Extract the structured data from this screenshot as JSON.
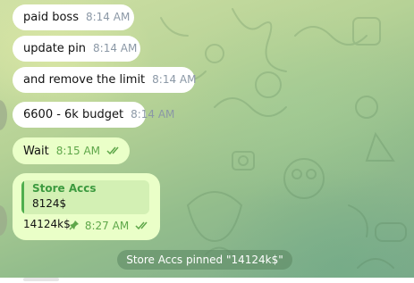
{
  "messages": [
    {
      "text": "paid boss",
      "time": "8:14 AM"
    },
    {
      "text": "update pin",
      "time": "8:14 AM"
    },
    {
      "text": "and remove the limit",
      "time": "8:14 AM"
    },
    {
      "text": "6600 - 6k budget",
      "time": "8:14 AM"
    },
    {
      "text": "Wait",
      "time": "8:15 AM"
    }
  ],
  "reply_message": {
    "quote_name": "Store Accs",
    "quote_text": "8124$",
    "text": "14124k$",
    "time": "8:27 AM"
  },
  "service_message": "Store Accs pinned \"14124k$\"",
  "colors": {
    "incoming_bubble": "#ffffff",
    "outgoing_bubble": "#eaffc8",
    "accent_green": "#4fae4e",
    "time_gray": "#8b98a6"
  },
  "icons": [
    "double-check-icon",
    "pin-icon"
  ]
}
